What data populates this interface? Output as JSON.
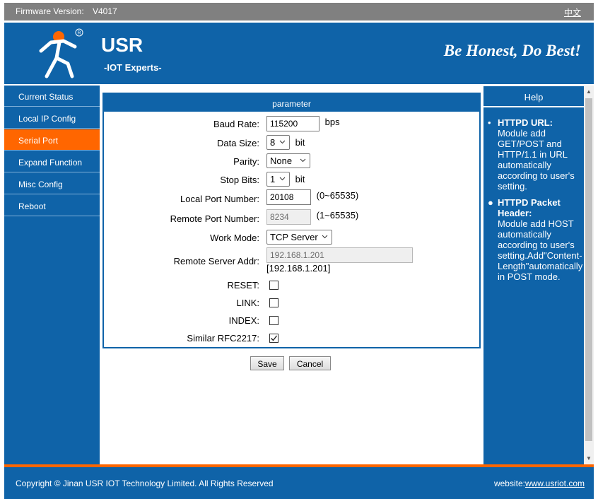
{
  "topbar": {
    "firmware_label": "Firmware Version:",
    "firmware_value": "V4017",
    "language_link": "中文"
  },
  "header": {
    "brand": "USR",
    "subtitle": "-IOT Experts-",
    "slogan": "Be Honest, Do Best!",
    "logo_icon": "usr-runner-logo",
    "logo_mark": "R"
  },
  "sidebar": {
    "items": [
      {
        "label": "Current Status"
      },
      {
        "label": "Local IP Config"
      },
      {
        "label": "Serial Port",
        "active": true
      },
      {
        "label": "Expand Function"
      },
      {
        "label": "Misc Config"
      },
      {
        "label": "Reboot"
      }
    ]
  },
  "form": {
    "title": "parameter",
    "baud_rate": {
      "label": "Baud Rate:",
      "value": "115200",
      "unit": "bps"
    },
    "data_size": {
      "label": "Data Size:",
      "value": "8",
      "unit": "bit"
    },
    "parity": {
      "label": "Parity:",
      "value": "None"
    },
    "stop_bits": {
      "label": "Stop Bits:",
      "value": "1",
      "unit": "bit"
    },
    "local_port": {
      "label": "Local Port Number:",
      "value": "20108",
      "range": "(0~65535)"
    },
    "remote_port": {
      "label": "Remote Port Number:",
      "value": "8234",
      "range": "(1~65535)"
    },
    "work_mode": {
      "label": "Work Mode:",
      "value": "TCP Server"
    },
    "remote_server": {
      "label": "Remote Server Addr:",
      "value": "192.168.1.201",
      "current": "[192.168.1.201]"
    },
    "reset": {
      "label": "RESET:",
      "checked": false
    },
    "link": {
      "label": "LINK:",
      "checked": false
    },
    "index": {
      "label": "INDEX:",
      "checked": false
    },
    "rfc2217": {
      "label": "Similar RFC2217:",
      "checked": true
    },
    "save_label": "Save",
    "cancel_label": "Cancel"
  },
  "help": {
    "title": "Help",
    "items": [
      {
        "bullet": "•",
        "heading": "HTTPD URL:",
        "text": "Module add GET/POST and HTTP/1.1 in URL automatically according to user's setting."
      },
      {
        "bullet": "●",
        "heading": "HTTPD Packet Header:",
        "text": "Module add HOST automatically according to user's setting.Add\"Content-Length\"automatically in POST mode."
      }
    ]
  },
  "footer": {
    "copyright": "Copyright © Jinan USR IOT Technology Limited. All Rights Reserved",
    "website_label": "website:",
    "website_link": "www.usriot.com"
  },
  "colors": {
    "primary": "#0f63a8",
    "accent": "#ff6600",
    "topbar": "#808080"
  }
}
